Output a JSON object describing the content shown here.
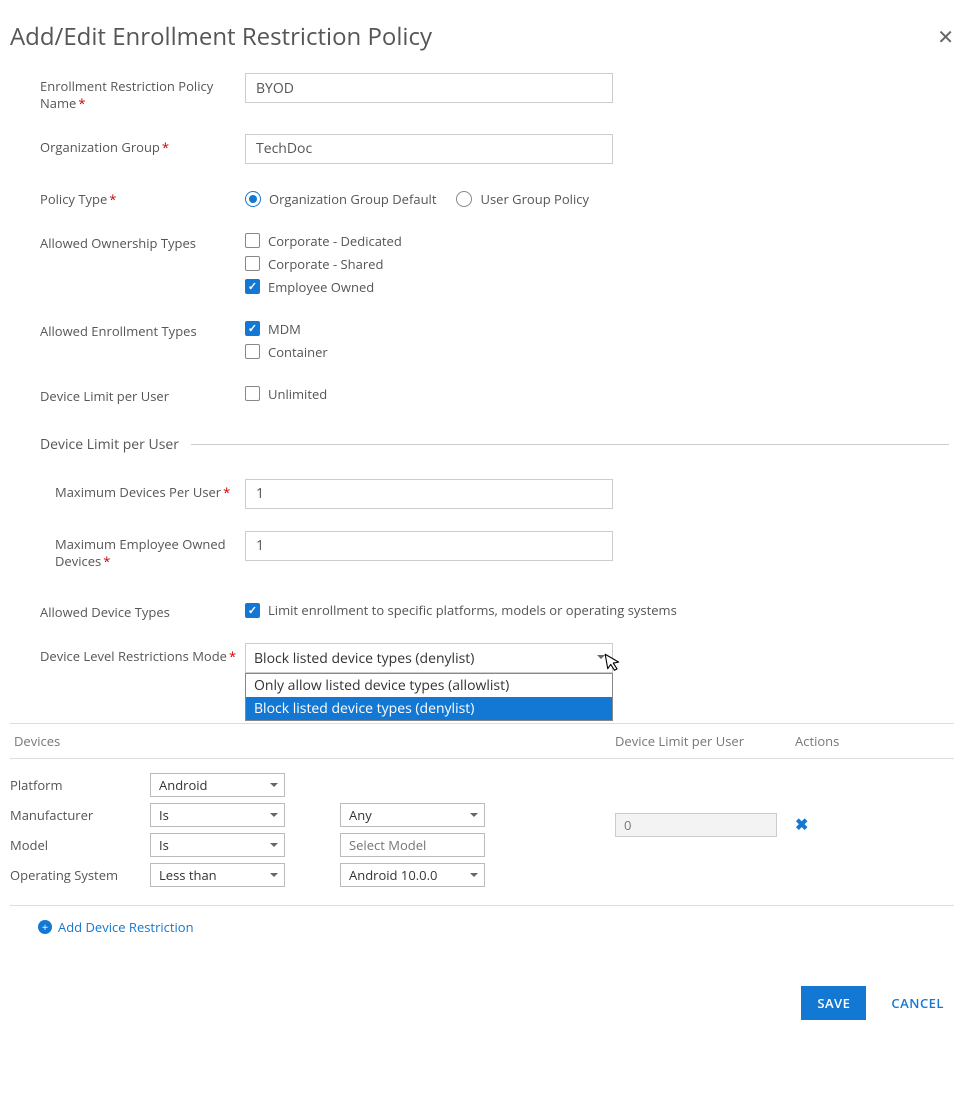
{
  "dialogTitle": "Add/Edit Enrollment Restriction Policy",
  "labels": {
    "policyName": "Enrollment Restriction Policy Name",
    "orgGroup": "Organization Group",
    "policyType": "Policy Type",
    "ownership": "Allowed Ownership Types",
    "enrollment": "Allowed Enrollment Types",
    "deviceLimit": "Device Limit per User",
    "section": "Device Limit per User",
    "maxDevices": "Maximum Devices Per User",
    "maxEmpOwned": "Maximum Employee Owned Devices",
    "allowedDeviceTypes": "Allowed Device Types",
    "restrictMode": "Device Level Restrictions Mode"
  },
  "values": {
    "policyName": "BYOD",
    "orgGroup": "TechDoc",
    "maxDevices": "1",
    "maxEmpOwned": "1",
    "devLimitPerUser": "0"
  },
  "policyType": {
    "opt1": "Organization Group Default",
    "opt2": "User Group Policy",
    "selected": "opt1"
  },
  "ownership": {
    "corpDedicated": "Corporate - Dedicated",
    "corpShared": "Corporate - Shared",
    "empOwned": "Employee Owned"
  },
  "enrollment": {
    "mdm": "MDM",
    "container": "Container"
  },
  "deviceLimitUnlimited": "Unlimited",
  "allowedDeviceTypesCheck": "Limit enrollment to specific platforms, models or operating systems",
  "restrictMode": {
    "current": "Block listed device types (denylist)",
    "opt1": "Only allow listed device types (allowlist)",
    "opt2": "Block listed device types (denylist)"
  },
  "table": {
    "colDevices": "Devices",
    "colLimit": "Device Limit per User",
    "colActions": "Actions",
    "row": {
      "platformLabel": "Platform",
      "platformVal": "Android",
      "manufacturerLabel": "Manufacturer",
      "manufacturerOp": "Is",
      "manufacturerVal": "Any",
      "modelLabel": "Model",
      "modelOp": "Is",
      "modelValPlaceholder": "Select Model",
      "osLabel": "Operating System",
      "osOp": "Less than",
      "osVal": "Android 10.0.0"
    },
    "addLink": "Add Device Restriction"
  },
  "buttons": {
    "save": "SAVE",
    "cancel": "CANCEL"
  }
}
